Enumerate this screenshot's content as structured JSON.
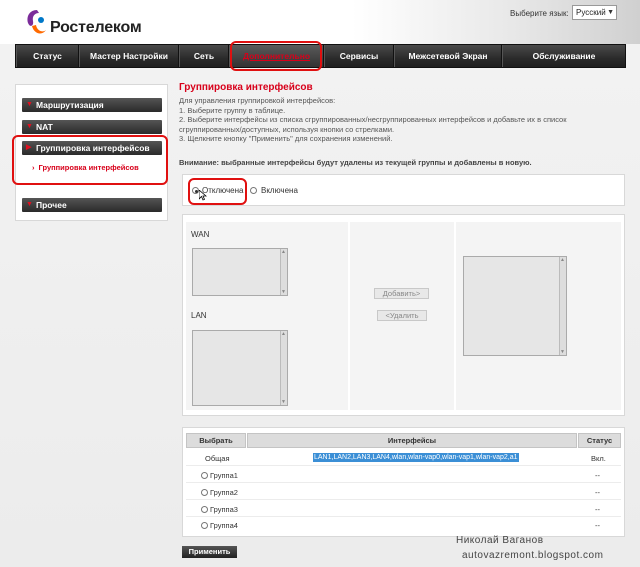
{
  "brand": {
    "name": "Ростелеком"
  },
  "language": {
    "label": "Выберите язык:",
    "selected": "Русский"
  },
  "nav": {
    "items": [
      "Статус",
      "Мастер Настройки",
      "Сеть",
      "Дополнительно",
      "Сервисы",
      "Межсетевой Экран",
      "Обслуживание"
    ],
    "active": "Дополнительно"
  },
  "sidebar": {
    "items": [
      "Маршрутизация",
      "NAT",
      "Группировка интерфейсов",
      "Прочее"
    ],
    "subitem": "Группировка интерфейсов"
  },
  "main": {
    "title": "Группировка интерфейсов",
    "intro": [
      "Для управления группировкой интерфейсов:",
      "1. Выберите группу в таблице.",
      "2. Выберите интерфейсы из списка сгруппированных/несгруппированных интерфейсов и добавьте их в список",
      "сгруппированных/доступных, используя кнопки со стрелками.",
      "3. Щелкните кнопку \"Применить\" для сохранения изменений."
    ],
    "warning": "Внимание: выбранные интерфейсы будут удалены из текущей группы и добавлены в новую.",
    "mode": {
      "off_label": "Отключена",
      "on_label": "Включена",
      "selected": "Отключена"
    },
    "wan_label": "WAN",
    "lan_label": "LAN",
    "add_label": "Добавить>",
    "remove_label": "<Удалить"
  },
  "table": {
    "headers": [
      "Выбрать",
      "Интерфейсы",
      "Статус"
    ],
    "rows": [
      {
        "select": "Общая",
        "interfaces": "LAN1,LAN2,LAN3,LAN4,wlan,wlan-vap0,wlan-vap1,wlan-vap2,a1",
        "status": "Вкл."
      },
      {
        "select": "Группа1",
        "interfaces": "",
        "status": "--"
      },
      {
        "select": "Группа2",
        "interfaces": "",
        "status": "--"
      },
      {
        "select": "Группа3",
        "interfaces": "",
        "status": "--"
      },
      {
        "select": "Группа4",
        "interfaces": "",
        "status": "--"
      }
    ]
  },
  "apply_label": "Применить",
  "watermark": {
    "name": "Николай Ваганов",
    "site": "autovazremont.blogspot.com"
  },
  "colors": {
    "accent": "#d8001a",
    "highlight": "#e01010",
    "selection": "#3b8fd6"
  }
}
